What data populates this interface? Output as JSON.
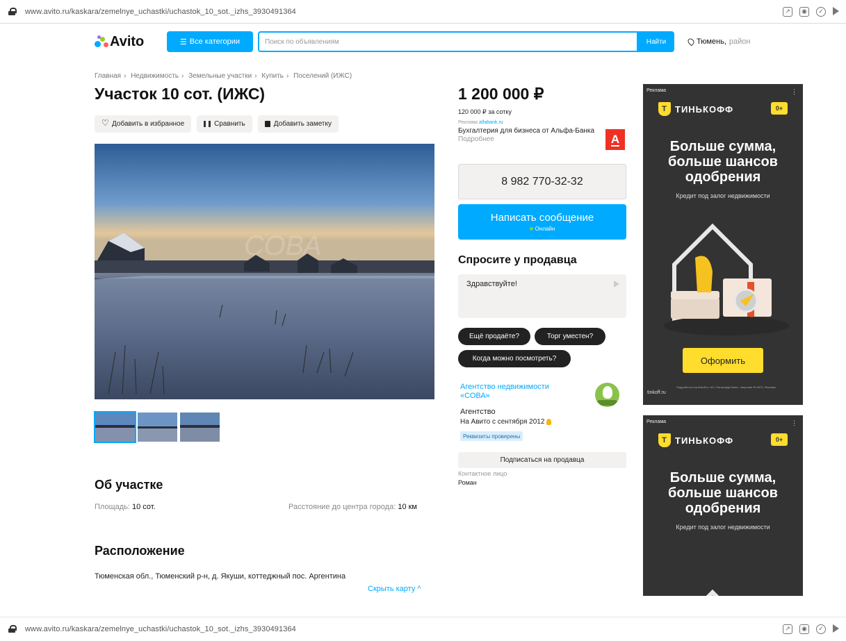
{
  "browser": {
    "url": "www.avito.ru/kaskara/zemelnye_uchastki/uchastok_10_sot._izhs_3930491364"
  },
  "header": {
    "logo": "Avito",
    "categories_label": "Все категории",
    "search_placeholder": "Поиск по объявлениям",
    "search_button": "Найти",
    "location_city": "Тюмень,",
    "location_area": "район"
  },
  "breadcrumb": [
    "Главная",
    "Недвижимость",
    "Земельные участки",
    "Купить",
    "Поселений (ИЖС)"
  ],
  "listing": {
    "title": "Участок 10 сот. (ИЖС)",
    "actions": {
      "favorite": "Добавить в избранное",
      "compare": "Сравнить",
      "note": "Добавить заметку"
    },
    "price": "1 200 000 ₽",
    "price_per": "120 000 ₽ за сотку"
  },
  "promo": {
    "tag": "Реклама",
    "tag_link": "alfabank.ru",
    "text": "Бухгалтерия для бизнеса от Альфа-Банка",
    "more": "Подробнее",
    "logo_letter": "А"
  },
  "contact": {
    "phone": "8 982 770-32-32",
    "message_button": "Написать сообщение",
    "online": "Онлайн",
    "ask_title": "Спросите у продавца",
    "ask_message": "Здравствуйте!",
    "quick_replies": [
      "Ещё продаёте?",
      "Торг уместен?",
      "Когда можно посмотреть?"
    ]
  },
  "seller": {
    "name": "Агентство недвижимости «СОВА»",
    "type": "Агентство",
    "since": "На Авито с сентября 2012",
    "verified": "Реквизиты проверены",
    "subscribe": "Подписаться на продавца",
    "contact_label": "Контактное лицо",
    "contact_name": "Роман"
  },
  "about": {
    "title": "Об участке",
    "area_label": "Площадь:",
    "area_value": "10 сот.",
    "distance_label": "Расстояние до центра города:",
    "distance_value": "10 км"
  },
  "location": {
    "title": "Расположение",
    "address": "Тюменская обл., Тюменский р-н, д. Якуши, коттеджный пос. Аргентина",
    "hide_map": "Скрыть карту ^"
  },
  "photo": {
    "watermark": "СОВА",
    "thumbnail_count": 3
  },
  "ads": [
    {
      "label": "Реклама",
      "brand": "ТИНЬКОФФ",
      "brand_mark": "Т",
      "age": "0+",
      "headline": "Больше сумма, больше шансов одобрения",
      "sub": "Кредит под залог недвижимости",
      "cta": "Оформить",
      "fine": "Подробности на tinkoff.ru. АО «Тинькофф Банк», лицензия № 2673. Реклама.",
      "domain": "tinkoff.ru"
    },
    {
      "label": "Реклама",
      "brand": "ТИНЬКОФФ",
      "brand_mark": "Т",
      "age": "0+",
      "headline": "Больше сумма, больше шансов одобрения",
      "sub": "Кредит под залог недвижимости"
    }
  ],
  "colors": {
    "accent": "#00aaff",
    "ad_bg": "#333333",
    "ad_yellow": "#ffdd2d",
    "alfa_red": "#ef3124"
  },
  "icons": [
    "lock-icon",
    "share-icon",
    "camera-icon",
    "extension-icon",
    "play-icon",
    "pin-icon",
    "heart-icon",
    "compare-icon",
    "note-icon",
    "send-icon",
    "medal-icon"
  ]
}
